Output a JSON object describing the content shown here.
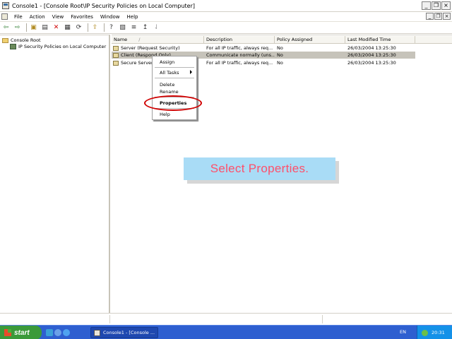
{
  "window": {
    "title": "Console1 - [Console Root\\IP Security Policies on Local Computer]",
    "minimize_glyph": "_",
    "maximize_glyph": "□",
    "close_glyph": "×",
    "restore_glyph": "❐"
  },
  "menu": {
    "items": [
      "File",
      "Action",
      "View",
      "Favorites",
      "Window",
      "Help"
    ]
  },
  "toolbar": {
    "buttons": [
      {
        "icon": "back-arrow-icon",
        "glyph": "⇦"
      },
      {
        "icon": "forward-arrow-icon",
        "glyph": "⇨"
      },
      {
        "icon": "up-folder-icon",
        "glyph": "▣"
      },
      {
        "icon": "show-tree-icon",
        "glyph": "▤"
      },
      {
        "icon": "delete-icon",
        "glyph": "✕"
      },
      {
        "icon": "properties-icon",
        "glyph": "▦"
      },
      {
        "icon": "refresh-icon",
        "glyph": "⟳"
      },
      {
        "icon": "export-icon",
        "glyph": "⇪"
      },
      {
        "icon": "help-icon",
        "glyph": "?"
      },
      {
        "icon": "add-policy-icon",
        "glyph": "▧"
      },
      {
        "icon": "manage-filters-icon",
        "glyph": "≡"
      },
      {
        "icon": "assign-icon",
        "glyph": "↥"
      },
      {
        "icon": "unassign-icon",
        "glyph": "⇃"
      }
    ]
  },
  "tree": {
    "root": "Console Root",
    "child": "IP Security Policies on Local Computer"
  },
  "list": {
    "columns": [
      "Name",
      "Description",
      "Policy Assigned",
      "Last Modified Time"
    ],
    "sort_glyph": "/",
    "rows": [
      {
        "name": "Server (Request Security)",
        "description": "For all IP traffic, always req...",
        "assigned": "No",
        "modified": "26/03/2004 13:25:30"
      },
      {
        "name": "Client (Respond Only)",
        "description": "Communicate normally (uns...",
        "assigned": "No",
        "modified": "26/03/2004 13:25:30",
        "selected": true
      },
      {
        "name": "Secure Server",
        "description": "For all IP traffic, always req...",
        "assigned": "No",
        "modified": "26/03/2004 13:25:30"
      }
    ]
  },
  "context_menu": {
    "assign": "Assign",
    "all_tasks": "All Tasks",
    "delete": "Delete",
    "rename": "Rename",
    "properties": "Properties",
    "help": "Help"
  },
  "callout": {
    "text": "Select Properties."
  },
  "colors": {
    "callout_bg": "#a9dcf6",
    "callout_text": "#ff4f6a",
    "highlight_oval": "#d00000",
    "taskbar": "#2e5fd0",
    "start_button": "#3b9a3a"
  },
  "taskbar": {
    "start_label": "start",
    "task_label": "Console1 - [Console ...",
    "language": "EN",
    "clock": "20:31"
  }
}
